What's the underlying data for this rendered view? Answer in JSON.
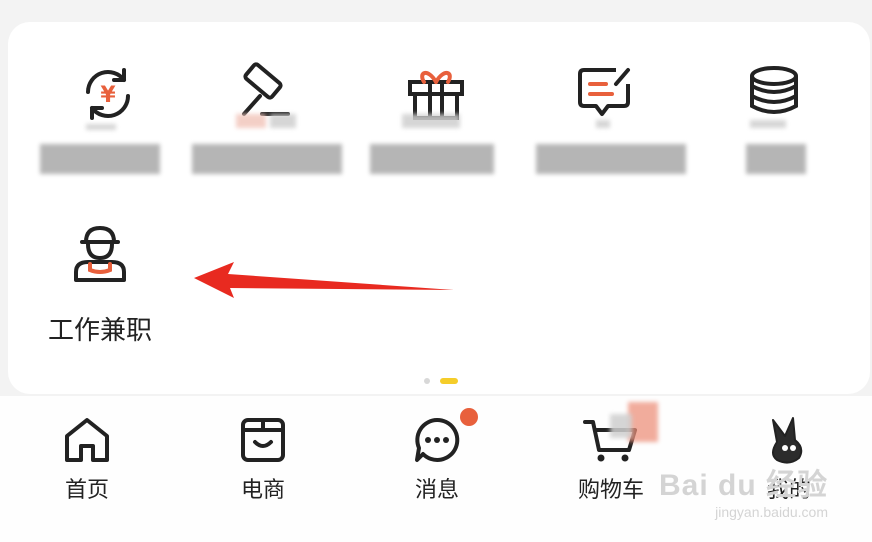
{
  "services": {
    "visible_item": {
      "label": "工作兼职",
      "icon": "worker-icon"
    },
    "icons": [
      "yuan-exchange-icon",
      "auction-hammer-icon",
      "gift-box-icon",
      "message-edit-icon",
      "coin-stack-icon"
    ]
  },
  "tabbar": {
    "items": [
      {
        "label": "首页",
        "icon": "home-icon"
      },
      {
        "label": "电商",
        "icon": "shopping-box-icon"
      },
      {
        "label": "消息",
        "icon": "chat-bubble-icon"
      },
      {
        "label": "购物车",
        "icon": "cart-icon"
      },
      {
        "label": "我的",
        "icon": "rabbit-profile-icon"
      }
    ]
  },
  "watermark": {
    "main": "Bai du 经验",
    "sub": "jingyan.baidu.com"
  },
  "colors": {
    "accent": "#e8603c",
    "indicator": "#f5cd2a",
    "arrow": "#e82a20",
    "text": "#222222"
  }
}
